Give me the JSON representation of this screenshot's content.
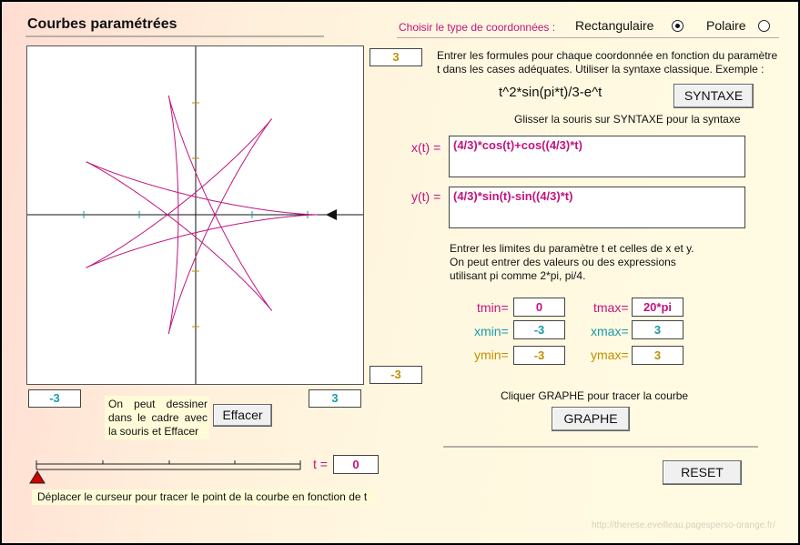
{
  "title": "Courbes paramétrées",
  "coord_choice": {
    "label": "Choisir le type de coordonnées :",
    "options": [
      {
        "label": "Rectangulaire",
        "selected": true
      },
      {
        "label": "Polaire",
        "selected": false
      }
    ]
  },
  "plot": {
    "ymax_value": "3",
    "ymin_value": "-3",
    "xmin_value": "-3",
    "xmax_value": "3",
    "curve_color": "#c0147f",
    "marker": "triangle-left"
  },
  "instructions": {
    "formulas": "Entrer les formules pour chaque coordonnée en fonction du paramètre t dans les cases adéquates. Utiliser la syntaxe classique. Exemple :",
    "example": "t^2*sin(pi*t)/3-e^t",
    "hover_syntax": "Glisser la souris sur SYNTAXE pour la syntaxe",
    "limits": "Entrer les limites  du paramètre t et celles de  x et  y.\nOn peut entrer des valeurs ou des expressions utilisant pi comme  2*pi, pi/4.",
    "graph": "Cliquer GRAPHE pour tracer la courbe"
  },
  "buttons": {
    "syntaxe": "SYNTAXE",
    "graphe": "GRAPHE",
    "reset": "RESET",
    "effacer": "Effacer"
  },
  "formulas": {
    "x_label": "x(t) =",
    "x_value": "(4/3)*cos(t)+cos((4/3)*t)",
    "y_label": "y(t) =",
    "y_value": "(4/3)*sin(t)-sin((4/3)*t)"
  },
  "limits": {
    "tmin_label": "tmin=",
    "tmin": "0",
    "tmax_label": "tmax=",
    "tmax": "20*pi",
    "xmin_label": "xmin=",
    "xmin": "-3",
    "xmax_label": "xmax=",
    "xmax": "3",
    "ymin_label": "ymin=",
    "ymin": "-3",
    "ymax_label": "ymax=",
    "ymax": "3"
  },
  "draw_note": "On peut dessiner dans le cadre avec la souris et Effacer",
  "slider": {
    "t_label": "t =",
    "t_value": "0",
    "caption": "Déplacer le curseur pour tracer le point de la courbe en fonction de t"
  },
  "footer_url": "http://therese.eveilleau.pagesperso-orange.fr/",
  "colors": {
    "magenta": "#c0147f",
    "teal": "#1a9aa8",
    "gold": "#c09000",
    "marker": "#cc0000"
  }
}
